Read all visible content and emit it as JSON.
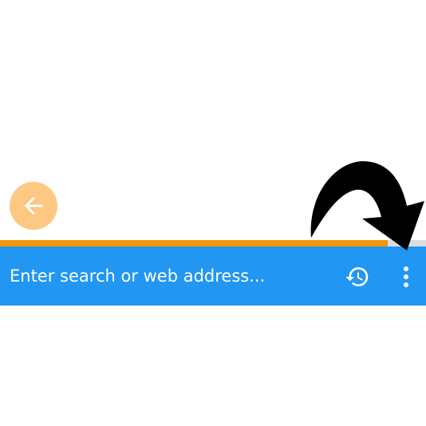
{
  "colors": {
    "toolbar": "#2196f3",
    "progress": "#f5950a",
    "progress_track": "#dcdcdc",
    "back_button": "#fdc881",
    "icon": "#ffffff",
    "annotation_arrow": "#000000"
  },
  "back_button": {
    "icon": "arrow-left-icon"
  },
  "progress": {
    "fraction": 0.91
  },
  "toolbar": {
    "url_placeholder": "Enter search or web address...",
    "history_icon": "history-icon",
    "menu_icon": "more-vertical-icon"
  },
  "annotation": {
    "icon": "curved-arrow-icon"
  }
}
